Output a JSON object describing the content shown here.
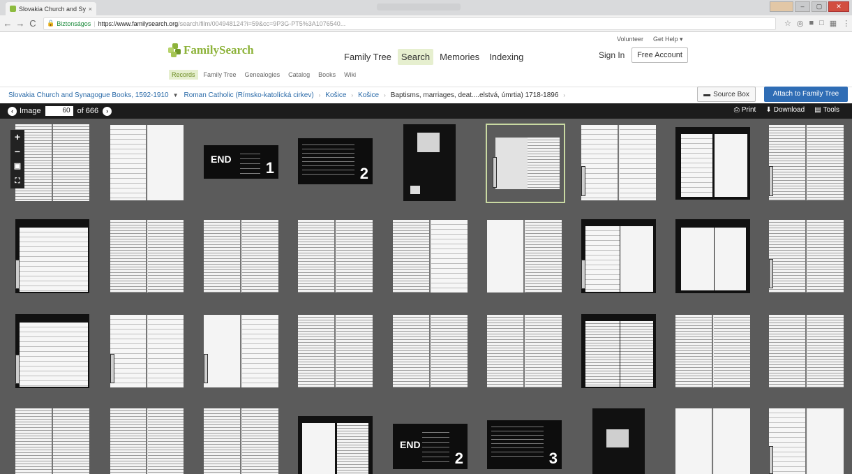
{
  "browser": {
    "tab_title": "Slovakia Church and Sy",
    "tab_close": "×",
    "secure_label": "Biztonságos",
    "url_host": "https://www.familysearch.org",
    "url_path": "/search/film/004948124?i=59&cc=9P3G-PT5%3A1076540...",
    "nav_back": "←",
    "nav_forward": "→",
    "nav_reload": "C"
  },
  "header": {
    "logo_text": "FamilySearch",
    "nav": [
      "Family Tree",
      "Search",
      "Memories",
      "Indexing"
    ],
    "active_nav": "Search",
    "volunteer": "Volunteer",
    "get_help": "Get Help ▾",
    "sign_in": "Sign In",
    "free_account": "Free Account",
    "sub_nav": [
      "Records",
      "Family Tree",
      "Genealogies",
      "Catalog",
      "Books",
      "Wiki"
    ],
    "active_sub": "Records"
  },
  "breadcrumb": {
    "collection": "Slovakia Church and Synagogue Books, 1592-1910",
    "items": [
      "Roman Catholic (Rímsko-katolícká cirkev)",
      "Košice",
      "Košice"
    ],
    "current": "Baptisms, marriages, deat....elstvá, úmrtia) 1718-1896",
    "source_box": "Source Box",
    "attach": "Attach to Family Tree"
  },
  "image_bar": {
    "image_label": "Image",
    "image_number": "60",
    "of_label": "of 666",
    "print": "Print",
    "download": "Download",
    "tools": "Tools"
  },
  "cards": {
    "end": "END",
    "n1": "1",
    "n2": "2",
    "n3": "3"
  },
  "colors": {
    "brand_green": "#8db33a",
    "attach_blue": "#2f6db5",
    "viewer_bg": "#5b5b5b",
    "toolbar_bg": "#1c1c1c"
  }
}
